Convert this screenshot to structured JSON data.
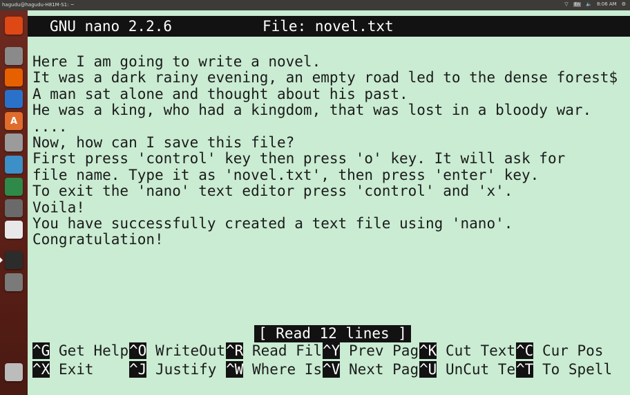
{
  "system_bar": {
    "window_title": "hagudu@hagudu-H81M-S1: ~",
    "lang": "En",
    "time": "8:06 AM"
  },
  "launcher": {
    "items": [
      {
        "icon": "ubuntu-logo-icon",
        "label": "",
        "color": "#dd4814"
      },
      {
        "icon": "files-icon",
        "label": "",
        "color": "#8a8a8a"
      },
      {
        "icon": "firefox-icon",
        "label": "",
        "color": "#e66000"
      },
      {
        "icon": "writer-icon",
        "label": "",
        "color": "#2a72c9"
      },
      {
        "icon": "software-center-icon",
        "label": "A",
        "color": "#e06c2c"
      },
      {
        "icon": "settings-icon",
        "label": "",
        "color": "#9b9b9b"
      },
      {
        "icon": "calc-icon",
        "label": "",
        "color": "#3c8fc7"
      },
      {
        "icon": "impress-icon",
        "label": "",
        "color": "#2f8a4a"
      },
      {
        "icon": "chess-icon",
        "label": "",
        "color": "#6a6a6a"
      },
      {
        "icon": "draw-icon",
        "label": "",
        "color": "#e8e8e8"
      },
      {
        "icon": "terminal-icon",
        "label": "",
        "color": "#2c2c2c"
      },
      {
        "icon": "video-icon",
        "label": "",
        "color": "#7a7a7a"
      },
      {
        "icon": "trash-icon",
        "label": "",
        "color": "#bcbcbc"
      }
    ]
  },
  "nano": {
    "version": "GNU nano 2.2.6",
    "file": "File: novel.txt",
    "lines": [
      "Here I am going to write a novel.",
      "It was a dark rainy evening, an empty road led to the dense forest$",
      "A man sat alone and thought about his past.",
      "He was a king, who had a kingdom, that was lost in a bloody war.",
      "....",
      "Now, how can I save this file?",
      "First press 'control' key then press 'o' key. It will ask for",
      "file name. Type it as 'novel.txt', then press 'enter' key.",
      "To exit the 'nano' text editor press 'control' and 'x'.",
      "Voila!",
      "You have successfully created a text file using 'nano'.",
      "Congratulation!"
    ],
    "status": "[ Read 12 lines ]",
    "shortcuts_row1": [
      {
        "key": "^G",
        "label": "Get Help"
      },
      {
        "key": "^O",
        "label": "WriteOut"
      },
      {
        "key": "^R",
        "label": "Read Fil"
      },
      {
        "key": "^Y",
        "label": "Prev Pag"
      },
      {
        "key": "^K",
        "label": "Cut Text"
      },
      {
        "key": "^C",
        "label": "Cur Pos"
      }
    ],
    "shortcuts_row2": [
      {
        "key": "^X",
        "label": "Exit"
      },
      {
        "key": "^J",
        "label": "Justify"
      },
      {
        "key": "^W",
        "label": "Where Is"
      },
      {
        "key": "^V",
        "label": "Next Pag"
      },
      {
        "key": "^U",
        "label": "UnCut Te"
      },
      {
        "key": "^T",
        "label": "To Spell"
      }
    ]
  },
  "colors": {
    "terminal_bg": "#c9ecd2",
    "inverse_bg": "#121212",
    "launcher_bg": "#5a1f16"
  }
}
